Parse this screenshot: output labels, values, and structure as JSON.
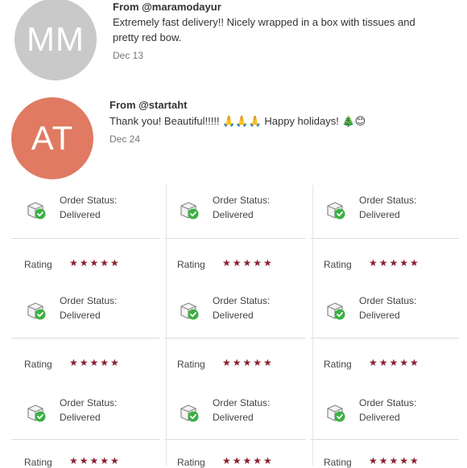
{
  "reviews": [
    {
      "initials": "MM",
      "avatar_color": "#c9c9c9",
      "from": "From @maramodayur",
      "message_line1": "Extremely fast delivery!! Nicely wrapped in a box with tissues and",
      "message_line2": "pretty red bow.",
      "date": "Dec 13"
    },
    {
      "initials": "AT",
      "avatar_color": "#e07a62",
      "from": "From @startaht",
      "message": "Thank you! Beautiful!!!!! 🙏🙏🙏 Happy holidays! 🎄😊",
      "date": "Dec 24"
    }
  ],
  "order_card": {
    "status_label": "Order Status:",
    "status_value": "Delivered",
    "rating_label": "Rating",
    "rating_stars": 5,
    "star_glyphs": "★★★★★",
    "icon": "box-check-icon",
    "accent_color": "#3cb043",
    "star_color": "#8b1f2f"
  }
}
